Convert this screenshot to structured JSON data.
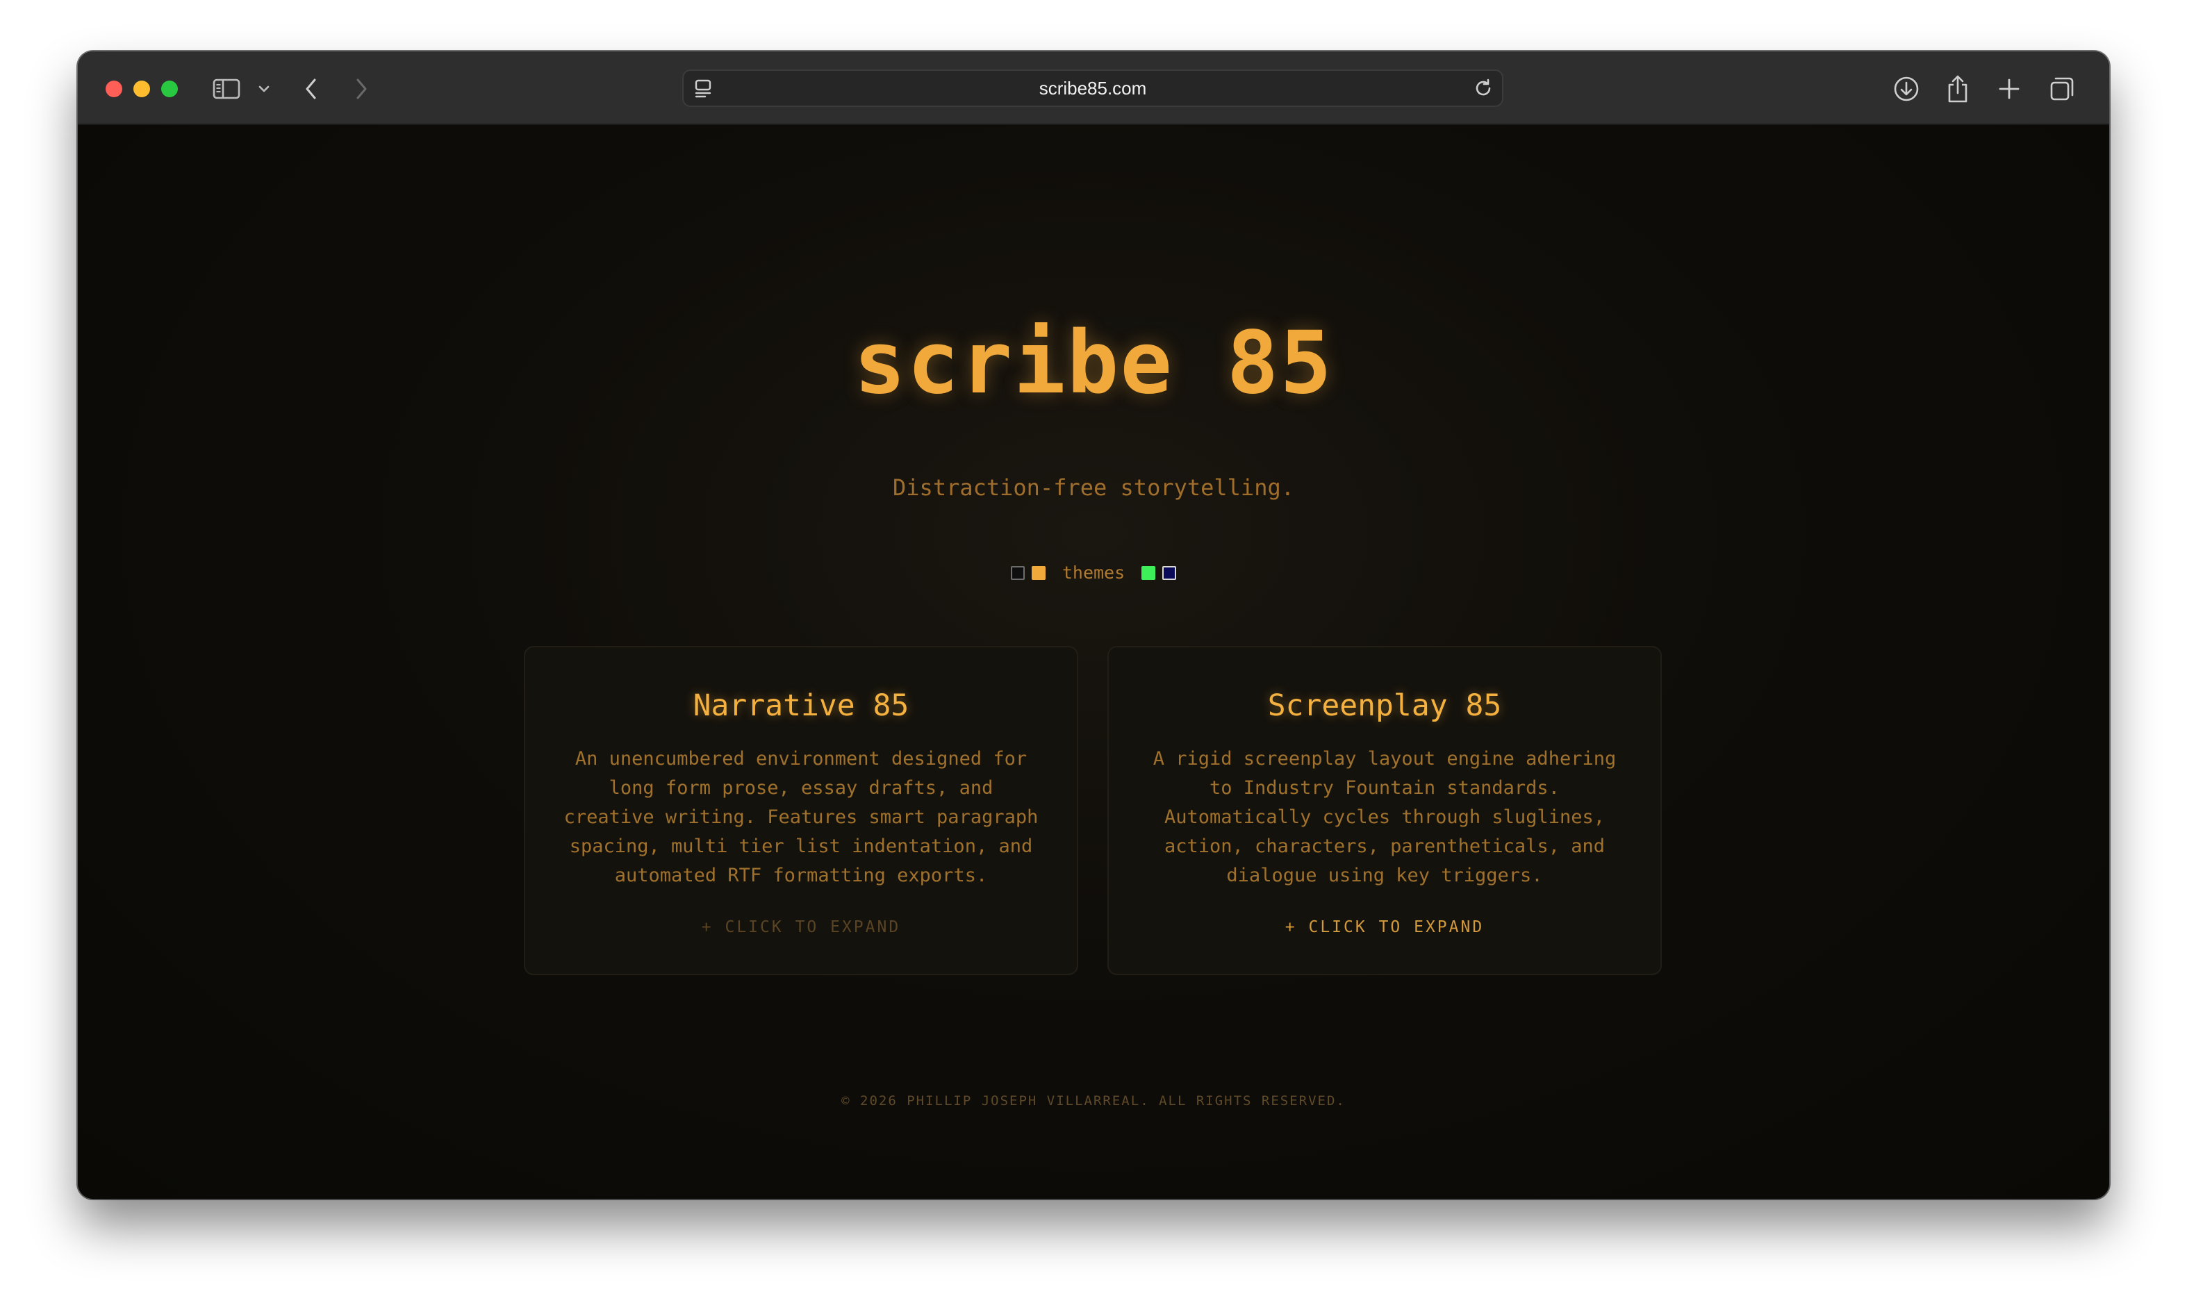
{
  "browser": {
    "url": "scribe85.com",
    "icons": {
      "sidebar": "sidebar-icon",
      "chevron": "chevron-down-icon",
      "back": "back-arrow-icon",
      "forward": "forward-arrow-icon",
      "page_menu": "page-menu-icon",
      "reload": "reload-icon",
      "downloads": "download-icon",
      "share": "share-icon",
      "new_tab": "plus-icon",
      "tab_overview": "tabs-overview-icon"
    }
  },
  "hero": {
    "title": "scribe 85",
    "subtitle": "Distraction-free storytelling."
  },
  "themes": {
    "label": "themes",
    "swatches": [
      {
        "name": "dark",
        "fill": "#0f0f10",
        "border": "#6d6d6d"
      },
      {
        "name": "amber",
        "fill": "#f2a93b",
        "border": "#f2a93b"
      },
      {
        "name": "green",
        "fill": "#3df05a",
        "border": "#3df05a"
      },
      {
        "name": "blue",
        "fill": "#0a0a5a",
        "border": "#d8d8d8"
      }
    ]
  },
  "cards": [
    {
      "title": "Narrative 85",
      "description": "An unencumbered environment designed for long form prose, essay drafts, and creative writing. Features smart paragraph spacing, multi tier list indentation, and automated RTF formatting exports.",
      "expand": "+ CLICK TO EXPAND"
    },
    {
      "title": "Screenplay 85",
      "description": "A rigid screenplay layout engine adhering to Industry Fountain standards. Automatically cycles through sluglines, action, characters, parentheticals, and dialogue using key triggers.",
      "expand": "+ CLICK TO EXPAND"
    }
  ],
  "footer": {
    "text": "© 2026 PHILLIP JOSEPH VILLARREAL. ALL RIGHTS RESERVED."
  },
  "colors": {
    "accent": "#f2a93b",
    "background": "#0a0906",
    "card": "#14120d"
  }
}
